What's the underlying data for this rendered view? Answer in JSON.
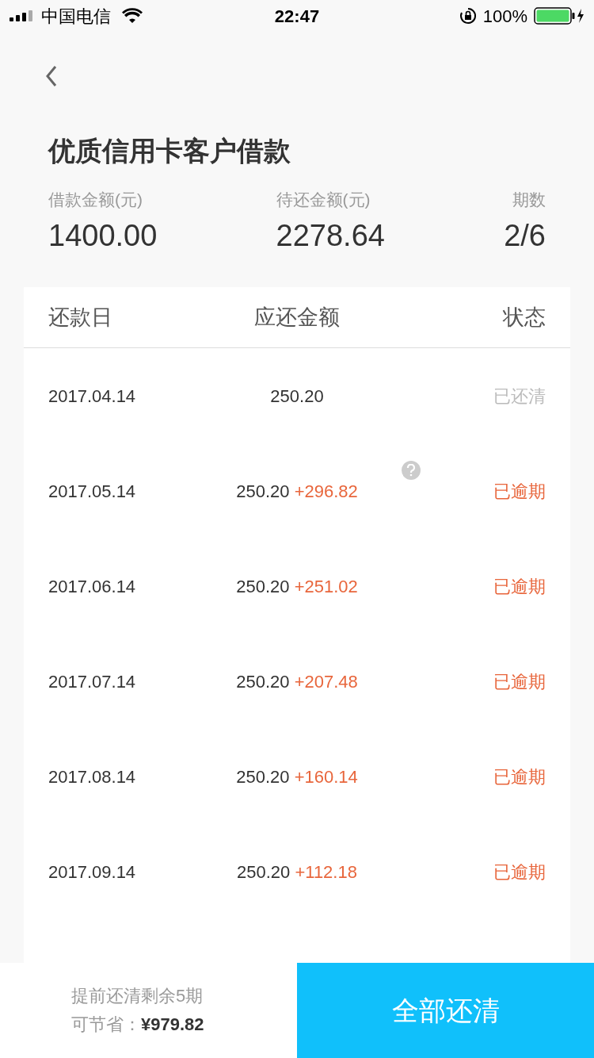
{
  "status_bar": {
    "carrier": "中国电信",
    "time": "22:47",
    "battery": "100%"
  },
  "title": "优质信用卡客户借款",
  "summary": [
    {
      "label": "借款金额(元)",
      "value": "1400.00"
    },
    {
      "label": "待还金额(元)",
      "value": "2278.64"
    },
    {
      "label": "期数",
      "value": "2/6"
    }
  ],
  "table": {
    "columns": [
      "还款日",
      "应还金额",
      "状态"
    ],
    "rows": [
      {
        "date": "2017.04.14",
        "amount": "250.20",
        "status": "已还清",
        "kind": "paid",
        "help": false
      },
      {
        "date": "2017.05.14",
        "amount": "250.20",
        "extra": "+296.82",
        "status": "已逾期",
        "kind": "overdue",
        "help": true
      },
      {
        "date": "2017.06.14",
        "amount": "250.20",
        "extra": "+251.02",
        "status": "已逾期",
        "kind": "overdue",
        "help": false
      },
      {
        "date": "2017.07.14",
        "amount": "250.20",
        "extra": "+207.48",
        "status": "已逾期",
        "kind": "overdue",
        "help": false
      },
      {
        "date": "2017.08.14",
        "amount": "250.20",
        "extra": "+160.14",
        "status": "已逾期",
        "kind": "overdue",
        "help": false
      },
      {
        "date": "2017.09.14",
        "amount": "250.20",
        "extra": "+112.18",
        "status": "已逾期",
        "kind": "overdue",
        "help": false
      }
    ]
  },
  "footer": {
    "note": "提前还清剩余5期",
    "saving_label": "可节省：",
    "saving": "¥979.82",
    "button": "全部还清"
  }
}
